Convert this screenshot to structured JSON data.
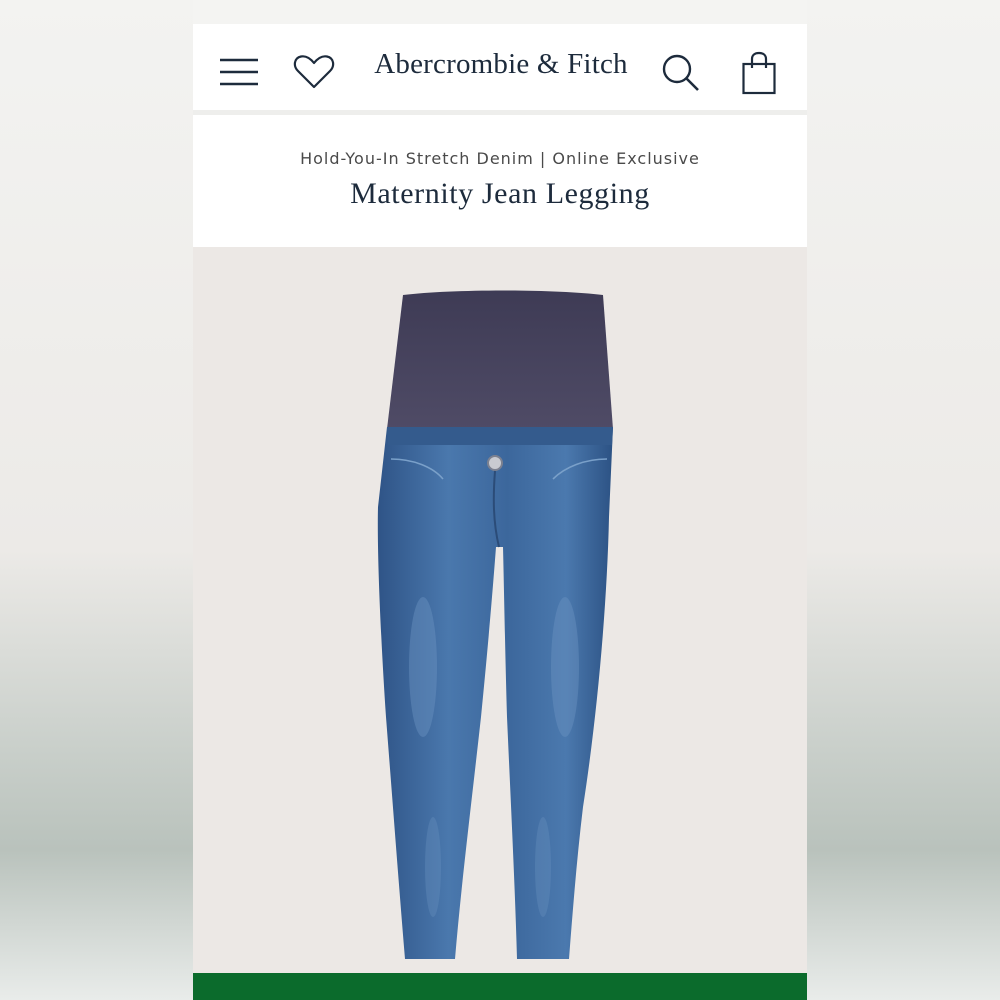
{
  "header": {
    "brand": "Abercrombie & Fitch",
    "icons": [
      "menu-icon",
      "heart-icon",
      "search-icon",
      "bag-icon"
    ]
  },
  "product": {
    "subtitle": "Hold-You-In Stretch Denim | Online Exclusive",
    "title": "Maternity Jean Legging"
  },
  "colors": {
    "brand_text": "#1d2b3c",
    "cta_green": "#0b6b2c",
    "waistband": "#4a4760",
    "denim": "#3f6aa0"
  }
}
